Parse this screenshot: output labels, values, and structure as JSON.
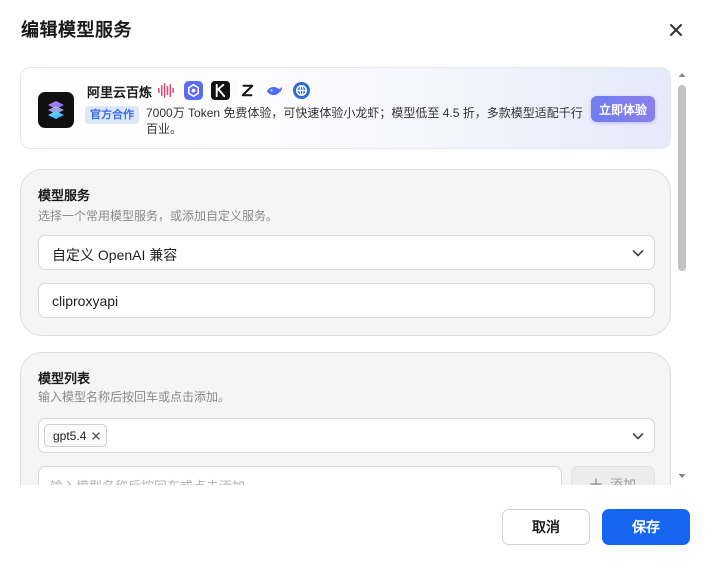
{
  "dialog": {
    "title": "编辑模型服务"
  },
  "promo": {
    "name": "阿里云百炼",
    "tag": "官方合作",
    "description": "7000万 Token 免费体验，可快速体验小龙虾；模型低至 4.5 折，多款模型适配千行百业。",
    "cta": "立即体验",
    "provider_icons": [
      "waveform-icon",
      "hexagon-icon",
      "kimi-icon",
      "zhipu-icon",
      "whale-icon",
      "globe-icon"
    ]
  },
  "model_service": {
    "title": "模型服务",
    "subtitle": "选择一个常用模型服务，或添加自定义服务。",
    "selected": "自定义 OpenAI 兼容",
    "name_value": "cliproxyapi"
  },
  "model_list": {
    "title": "模型列表",
    "subtitle": "输入模型名称后按回车或点击添加。",
    "tags": [
      "gpt5.4"
    ],
    "input_placeholder": "输入模型名称后按回车或点击添加",
    "add_label": "添加"
  },
  "footer": {
    "cancel": "取消",
    "save": "保存"
  },
  "colors": {
    "primary": "#1766f2",
    "tag_bg": "#dfe8fb",
    "tag_text": "#3d6fe0"
  }
}
